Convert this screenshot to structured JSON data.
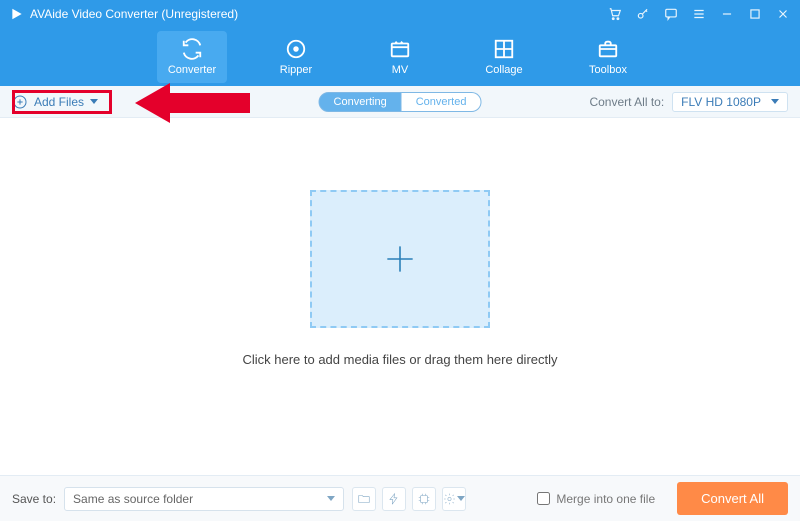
{
  "app": {
    "title": "AVAide Video Converter (Unregistered)"
  },
  "tabs": {
    "converter": "Converter",
    "ripper": "Ripper",
    "mv": "MV",
    "collage": "Collage",
    "toolbox": "Toolbox"
  },
  "secbar": {
    "add_files": "Add Files",
    "converting": "Converting",
    "converted": "Converted",
    "convert_all_to": "Convert All to:",
    "format": "FLV HD 1080P"
  },
  "main": {
    "drop_text": "Click here to add media files or drag them here directly"
  },
  "bottom": {
    "save_to_label": "Save to:",
    "save_to_value": "Same as source folder",
    "merge": "Merge into one file",
    "convert_all": "Convert All"
  }
}
